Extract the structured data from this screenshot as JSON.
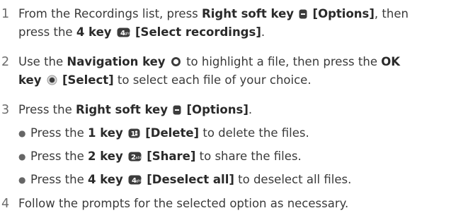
{
  "steps": [
    {
      "number": "1",
      "line1": {
        "t1": "From the Recordings list, press ",
        "b1": "Right soft key",
        "b2": "[Options]",
        "t2": ", then"
      },
      "line2": {
        "t1": "press the ",
        "b1": "4 key",
        "b2": "[Select recordings]",
        "t2": "."
      }
    },
    {
      "number": "2",
      "line1": {
        "t1": "Use the ",
        "b1": "Navigation key",
        "t2": " to highlight a file, then press the ",
        "b2": "OK"
      },
      "line2": {
        "b1": "key",
        "b2": "[Select]",
        "t1": " to select each file of your choice."
      }
    },
    {
      "number": "3",
      "line1": {
        "t1": "Press the ",
        "b1": "Right soft key",
        "b2": "[Options]",
        "t2": "."
      },
      "bullets": [
        {
          "t1": "Press the ",
          "b1": "1 key",
          "b2": "[Delete]",
          "t2": " to delete the files."
        },
        {
          "t1": "Press the ",
          "b1": "2 key",
          "b2": "[Share]",
          "t2": " to share the files."
        },
        {
          "t1": "Press the ",
          "b1": "4 key",
          "b2": "[Deselect all]",
          "t2": " to deselect all files."
        }
      ]
    },
    {
      "number": "4",
      "line1": {
        "t1": "Follow the prompts for the selected option as necessary."
      }
    }
  ],
  "icons": {
    "right_soft_key": "right-soft-key-icon",
    "key_4": "key-4-icon",
    "navigation_key": "navigation-key-icon",
    "ok_key": "ok-key-icon",
    "key_1": "key-1-icon",
    "key_2": "key-2-icon",
    "key_4_alt": "key-4-icon"
  },
  "colors": {
    "text": "#3a3a3a",
    "bold": "#2a2a2a",
    "key_fill": "#3c3c3c"
  }
}
